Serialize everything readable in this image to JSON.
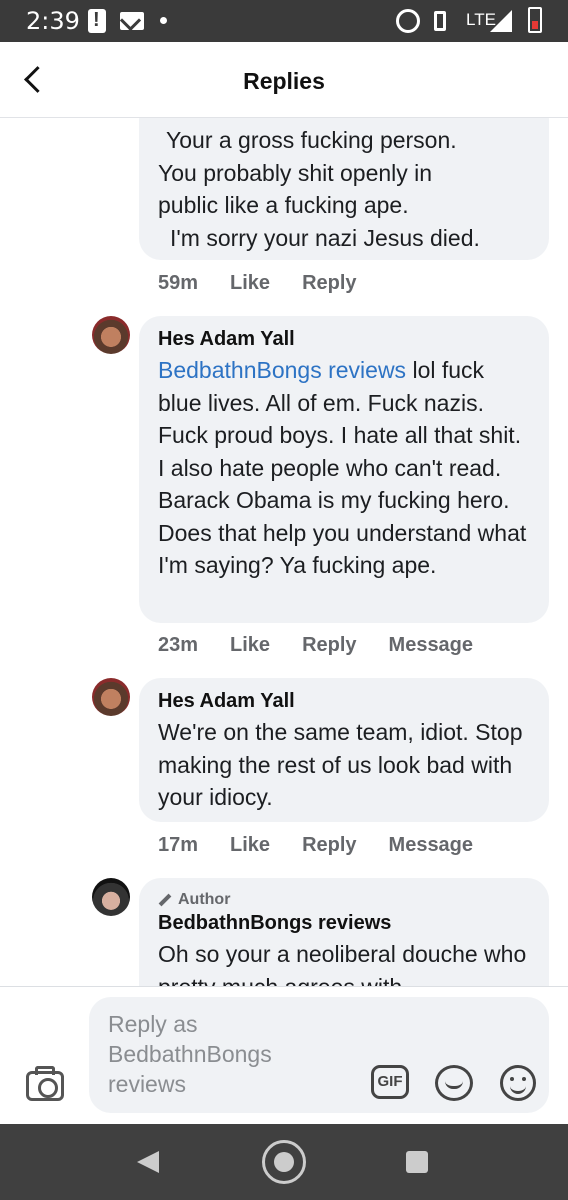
{
  "status_bar": {
    "time": "2:39",
    "network": "LTE"
  },
  "header": {
    "title": "Replies"
  },
  "comments": [
    {
      "partial": true,
      "text_lines": [
        "Your a gross fucking person.",
        "You probably shit openly in",
        "public like a fucking ape.",
        "I'm sorry your nazi Jesus died."
      ],
      "age": "59m",
      "like": "Like",
      "reply": "Reply"
    },
    {
      "author": "Hes Adam Yall",
      "mention": "BedbathnBongs reviews",
      "text": " lol fuck blue lives. All of em. Fuck nazis. Fuck proud boys. I hate all that shit. I also hate people who can't read. Barack Obama is my fucking hero. Does that help you understand what I'm saying? Ya fucking ape.",
      "age": "23m",
      "like": "Like",
      "reply": "Reply",
      "message": "Message"
    },
    {
      "author": "Hes Adam Yall",
      "text": "We're on the same team, idiot. Stop making the rest of us look bad with your idiocy.",
      "age": "17m",
      "like": "Like",
      "reply": "Reply",
      "message": "Message"
    },
    {
      "author_tag": "Author",
      "author": "BedbathnBongs reviews",
      "text": "Oh so your a neoliberal douche who pretty much agrees with"
    }
  ],
  "composer": {
    "placeholder": "Reply as BedbathnBongs reviews",
    "gif_label": "GIF"
  },
  "colors": {
    "mention": "#2d73c4",
    "bubble": "#f0f2f5",
    "meta": "#65676b"
  }
}
